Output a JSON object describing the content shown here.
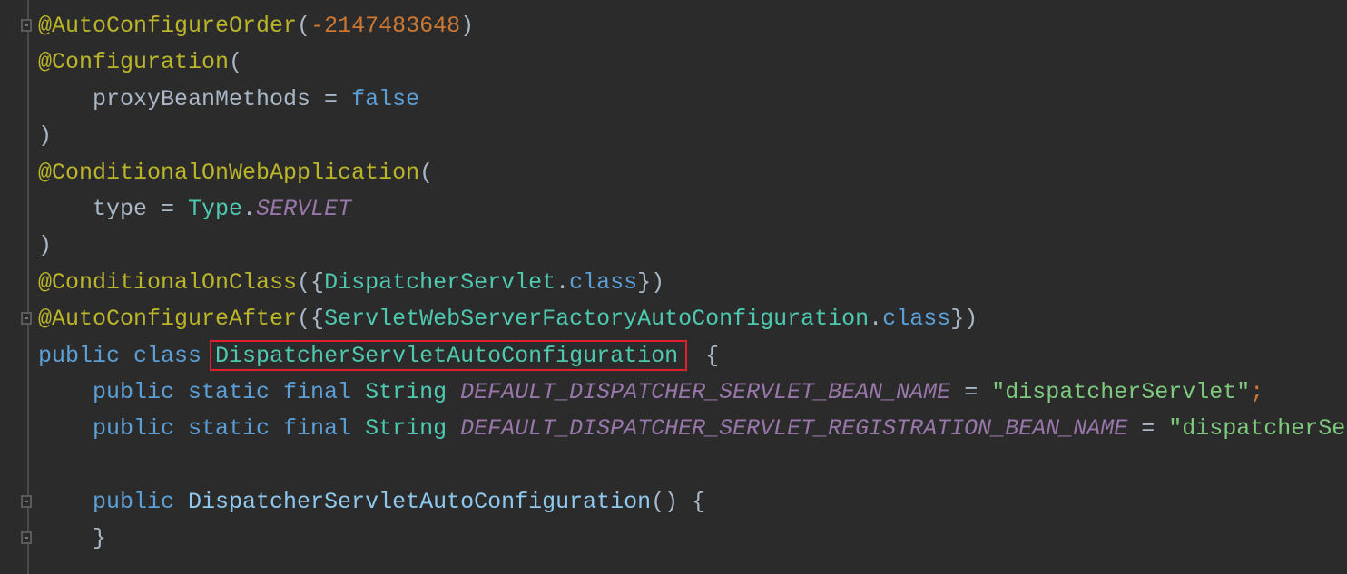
{
  "editor": {
    "highlight_color": "#e0202a",
    "lines": [
      {
        "fold": true,
        "tokens": [
          [
            "@AutoConfigureOrder",
            "ann"
          ],
          [
            "(",
            "paren"
          ],
          [
            "-2147483648",
            "num"
          ],
          [
            ")",
            "paren"
          ]
        ]
      },
      {
        "tokens": [
          [
            "@Configuration",
            "ann"
          ],
          [
            "(",
            "paren"
          ]
        ]
      },
      {
        "tokens": [
          [
            "    proxyBeanMethods = ",
            ""
          ],
          [
            "false",
            "kw"
          ]
        ]
      },
      {
        "tokens": [
          [
            ")",
            "paren"
          ]
        ]
      },
      {
        "tokens": [
          [
            "@ConditionalOnWebApplication",
            "ann"
          ],
          [
            "(",
            "paren"
          ]
        ]
      },
      {
        "tokens": [
          [
            "    type = ",
            ""
          ],
          [
            "Type",
            "cls"
          ],
          [
            ".",
            ""
          ],
          [
            "SERVLET",
            "const"
          ]
        ]
      },
      {
        "tokens": [
          [
            ")",
            "paren"
          ]
        ]
      },
      {
        "tokens": [
          [
            "@ConditionalOnClass",
            "ann"
          ],
          [
            "({",
            ""
          ],
          [
            "DispatcherServlet",
            "cls"
          ],
          [
            ".",
            ""
          ],
          [
            "class",
            "kw"
          ],
          [
            "})",
            ""
          ]
        ]
      },
      {
        "fold": true,
        "tokens": [
          [
            "@AutoConfigureAfter",
            "ann"
          ],
          [
            "({",
            ""
          ],
          [
            "ServletWebServerFactoryAutoConfiguration",
            "cls"
          ],
          [
            ".",
            ""
          ],
          [
            "class",
            "kw"
          ],
          [
            "})",
            ""
          ]
        ]
      },
      {
        "tokens": [
          [
            "public class ",
            "kw"
          ],
          [
            "DispatcherServletAutoConfiguration",
            "cls"
          ],
          [
            "  {",
            ""
          ]
        ]
      },
      {
        "tokens": [
          [
            "    public static final ",
            "kw"
          ],
          [
            "String ",
            "cls"
          ],
          [
            "DEFAULT_DISPATCHER_SERVLET_BEAN_NAME",
            "const"
          ],
          [
            " = ",
            ""
          ],
          [
            "\"dispatcherServlet\"",
            "str"
          ],
          [
            ";",
            "semi"
          ]
        ]
      },
      {
        "tokens": [
          [
            "    public static final ",
            "kw"
          ],
          [
            "String ",
            "cls"
          ],
          [
            "DEFAULT_DISPATCHER_SERVLET_REGISTRATION_BEAN_NAME",
            "const"
          ],
          [
            " = ",
            ""
          ],
          [
            "\"dispatcherSe",
            "str"
          ]
        ]
      },
      {
        "tokens": []
      },
      {
        "fold": true,
        "tokens": [
          [
            "    public ",
            "kw"
          ],
          [
            "DispatcherServletAutoConfiguration",
            "fn"
          ],
          [
            "() {",
            ""
          ]
        ]
      },
      {
        "fold": true,
        "tokens": [
          [
            "    }",
            ""
          ]
        ]
      }
    ]
  }
}
